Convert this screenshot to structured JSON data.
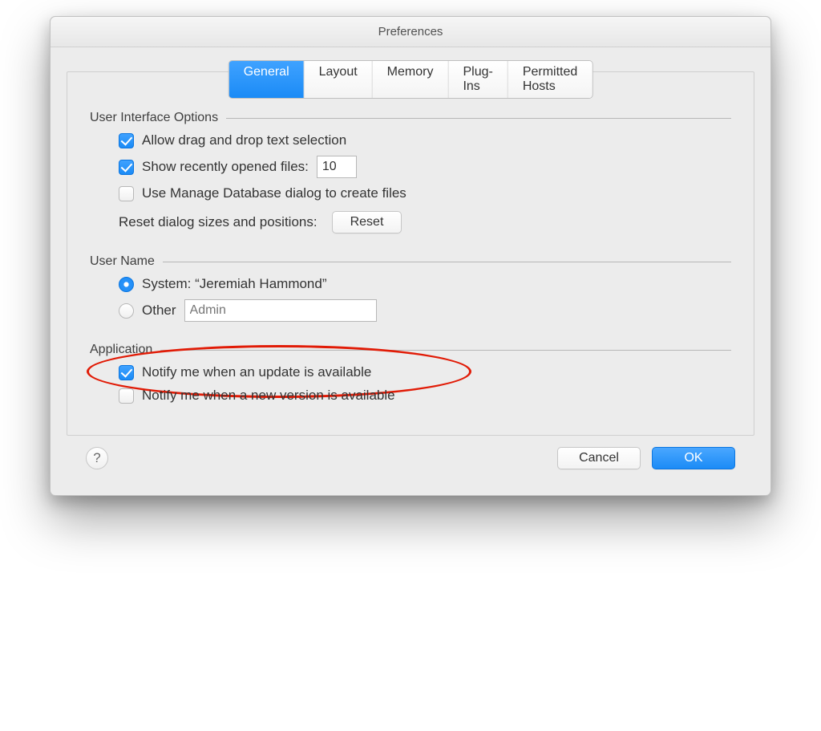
{
  "window": {
    "title": "Preferences"
  },
  "tabs": [
    {
      "label": "General",
      "active": true
    },
    {
      "label": "Layout",
      "active": false
    },
    {
      "label": "Memory",
      "active": false
    },
    {
      "label": "Plug-Ins",
      "active": false
    },
    {
      "label": "Permitted Hosts",
      "active": false
    }
  ],
  "sections": {
    "ui": {
      "heading": "User Interface Options",
      "allow_drag_label": "Allow drag and drop text selection",
      "allow_drag_checked": true,
      "recent_label": "Show recently opened files:",
      "recent_checked": true,
      "recent_value": "10",
      "manage_db_label": "Use Manage Database dialog to create files",
      "manage_db_checked": false,
      "reset_label": "Reset dialog sizes and positions:",
      "reset_button": "Reset"
    },
    "username": {
      "heading": "User Name",
      "system_label": "System: “Jeremiah Hammond”",
      "system_selected": true,
      "other_label": "Other",
      "other_selected": false,
      "other_value": "",
      "other_placeholder": "Admin"
    },
    "application": {
      "heading": "Application",
      "update_label": "Notify me when an update is available",
      "update_checked": true,
      "version_label": "Notify me when a new version is available",
      "version_checked": false
    }
  },
  "footer": {
    "help_glyph": "?",
    "cancel": "Cancel",
    "ok": "OK"
  }
}
